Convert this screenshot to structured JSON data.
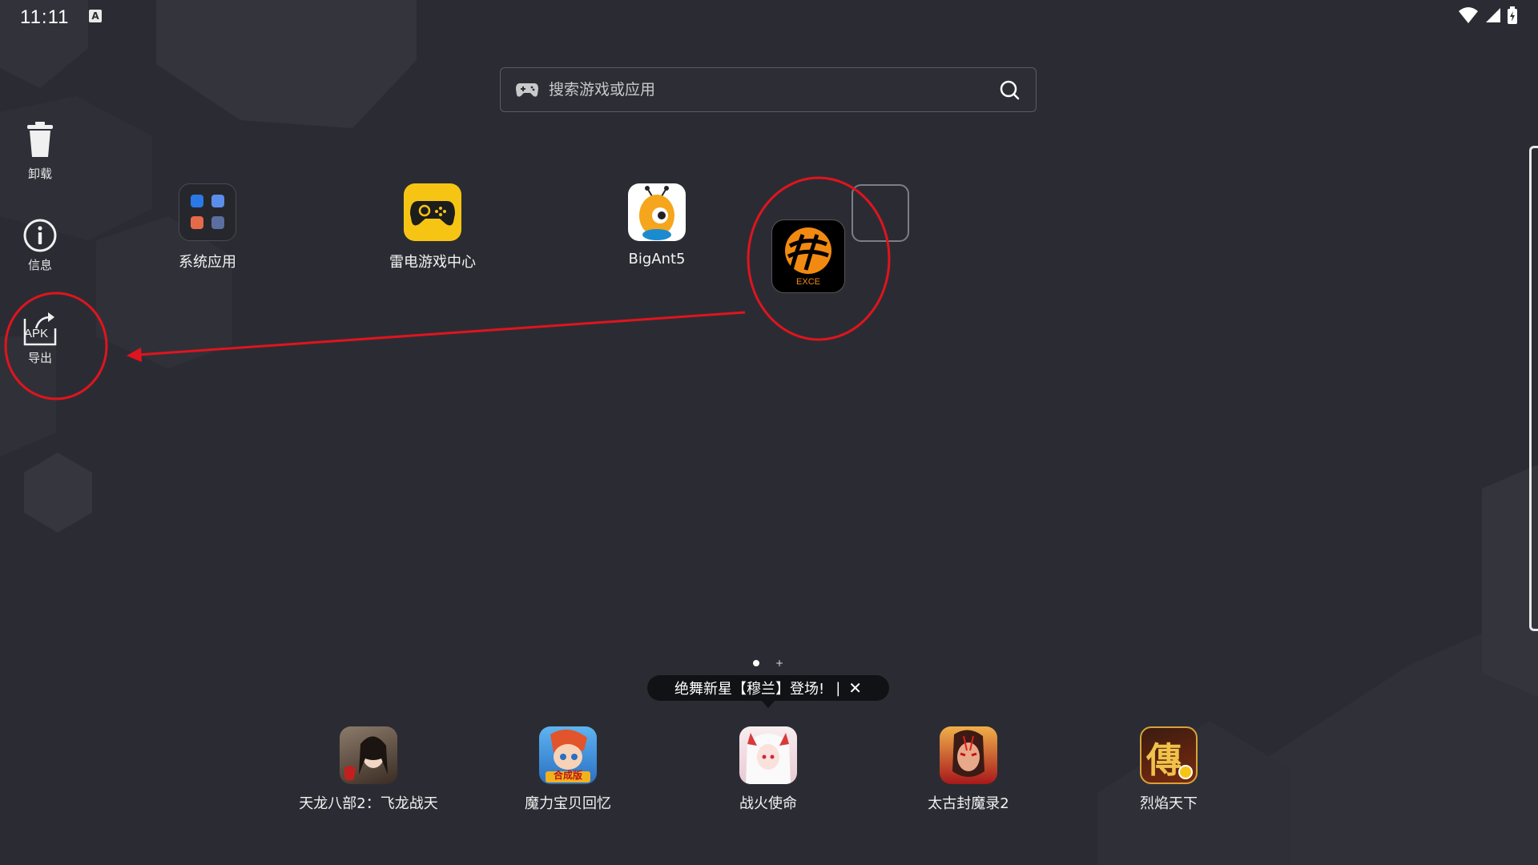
{
  "status_bar": {
    "time": "11:11",
    "notif_letter": "A"
  },
  "search": {
    "placeholder": "搜索游戏或应用"
  },
  "sidebar": {
    "items": [
      {
        "label": "卸载"
      },
      {
        "label": "信息"
      },
      {
        "label": "导出",
        "icon_text": "APK"
      }
    ]
  },
  "desktop": {
    "apps": [
      {
        "label": "系统应用"
      },
      {
        "label": "雷电游戏中心"
      },
      {
        "label": "BigAnt5"
      },
      {
        "label": "",
        "icon_text": "EXCE"
      }
    ]
  },
  "pager": {
    "plus": "+"
  },
  "banner": {
    "text": "绝舞新星【穆兰】登场!",
    "separator": "|",
    "close": "✕"
  },
  "dock": {
    "apps": [
      {
        "label": "天龙八部2：飞龙战天"
      },
      {
        "label": "魔力宝贝回忆",
        "badge": "合成版"
      },
      {
        "label": "战火使命"
      },
      {
        "label": "太古封魔录2"
      },
      {
        "label": "烈焰天下",
        "glyph": "傳"
      }
    ]
  },
  "colors": {
    "background": "#2b2c33",
    "annotation_red": "#e0141e",
    "game_center_yellow": "#f6c514",
    "exce_orange": "#f28a12"
  }
}
